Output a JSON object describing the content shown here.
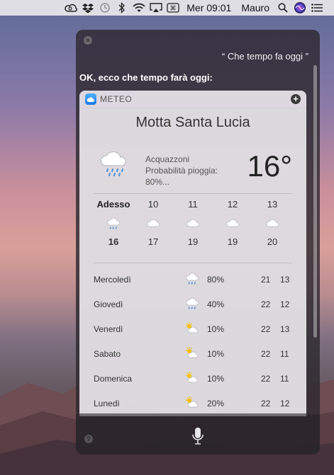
{
  "menubar": {
    "clock": "Mer 09:01",
    "user": "Mauro",
    "icons": [
      "creative-cloud-icon",
      "dropbox-icon",
      "time-machine-icon",
      "bluetooth-icon",
      "wifi-icon",
      "airplay-icon",
      "input-source-icon",
      "search-icon",
      "siri-icon",
      "notification-center-icon"
    ],
    "input_source_label": "⌘"
  },
  "siri": {
    "query": "“ Che tempo fa oggi ”",
    "answer": "OK, ecco che tempo farà oggi:",
    "close_glyph": "✕",
    "help_glyph": "?"
  },
  "weather": {
    "app_name": "METEO",
    "plus_glyph": "+",
    "city": "Motta Santa Lucia",
    "current": {
      "condition": "Acquazzoni",
      "rain_line1": "Probabilità pioggia:",
      "rain_line2": "80%...",
      "temperature": "16°",
      "icon": "rain-cloud-icon"
    },
    "hourly": [
      {
        "label": "Adesso",
        "temp": "16",
        "icon": "rain-cloud-icon"
      },
      {
        "label": "10",
        "temp": "17",
        "icon": "cloud-icon"
      },
      {
        "label": "11",
        "temp": "19",
        "icon": "cloud-icon"
      },
      {
        "label": "12",
        "temp": "19",
        "icon": "cloud-icon"
      },
      {
        "label": "13",
        "temp": "20",
        "icon": "cloud-icon"
      }
    ],
    "daily": [
      {
        "day": "Mercoledì",
        "icon": "rain-cloud-icon",
        "rain": "80%",
        "max": "21",
        "min": "13"
      },
      {
        "day": "Giovedì",
        "icon": "rain-cloud-icon",
        "rain": "40%",
        "max": "22",
        "min": "12"
      },
      {
        "day": "Venerdì",
        "icon": "partly-cloudy-icon",
        "rain": "10%",
        "max": "22",
        "min": "13"
      },
      {
        "day": "Sabato",
        "icon": "partly-cloudy-icon",
        "rain": "10%",
        "max": "22",
        "min": "11"
      },
      {
        "day": "Domenica",
        "icon": "partly-cloudy-icon",
        "rain": "10%",
        "max": "22",
        "min": "11"
      },
      {
        "day": "Lunedì",
        "icon": "partly-cloudy-icon",
        "rain": "20%",
        "max": "22",
        "min": "12"
      }
    ]
  }
}
